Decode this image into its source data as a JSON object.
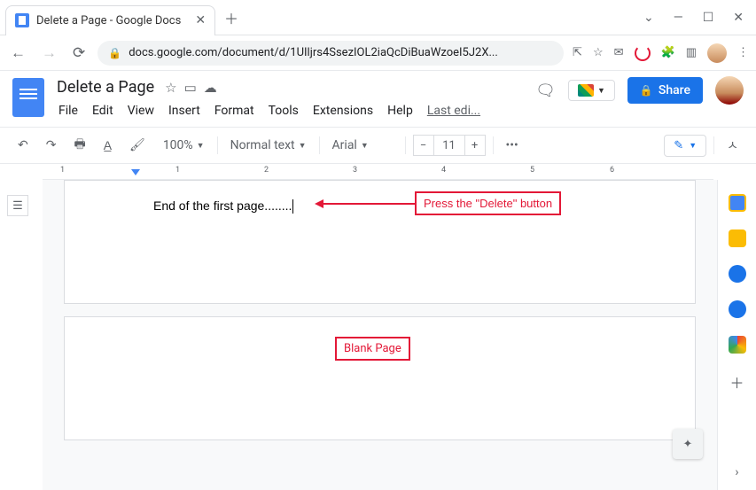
{
  "browser": {
    "tab_title": "Delete a Page - Google Docs",
    "url": "docs.google.com/document/d/1UIljrs4SsezIOL2iaQcDiBuaWzoeI5J2X..."
  },
  "doc": {
    "title": "Delete a Page",
    "menus": [
      "File",
      "Edit",
      "View",
      "Insert",
      "Format",
      "Tools",
      "Extensions",
      "Help"
    ],
    "last_edit": "Last edi...",
    "share_label": "Share"
  },
  "toolbar": {
    "zoom": "100%",
    "style": "Normal text",
    "font": "Arial",
    "font_size": "11"
  },
  "ruler": {
    "marks": [
      "1",
      "1",
      "2",
      "3",
      "4",
      "5",
      "6"
    ]
  },
  "content": {
    "line": "End of the first page........"
  },
  "annot": {
    "press_delete": "Press the \"Delete\" button",
    "blank_page": "Blank Page"
  }
}
